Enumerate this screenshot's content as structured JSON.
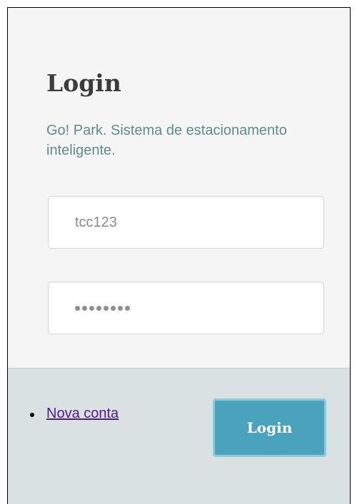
{
  "form": {
    "title": "Login",
    "subtitle": "Go! Park. Sistema de estacionamento inteligente.",
    "username_value": "tcc123",
    "password_mask": "••••••••",
    "password_length": 8
  },
  "footer": {
    "new_account_link": "Nova conta",
    "login_button": "Login"
  },
  "colors": {
    "button": "#4aa3bd",
    "subtitle": "#5f8c8a",
    "footer_bg": "#d9e1e2",
    "panel_bg": "#f5f5f5"
  }
}
